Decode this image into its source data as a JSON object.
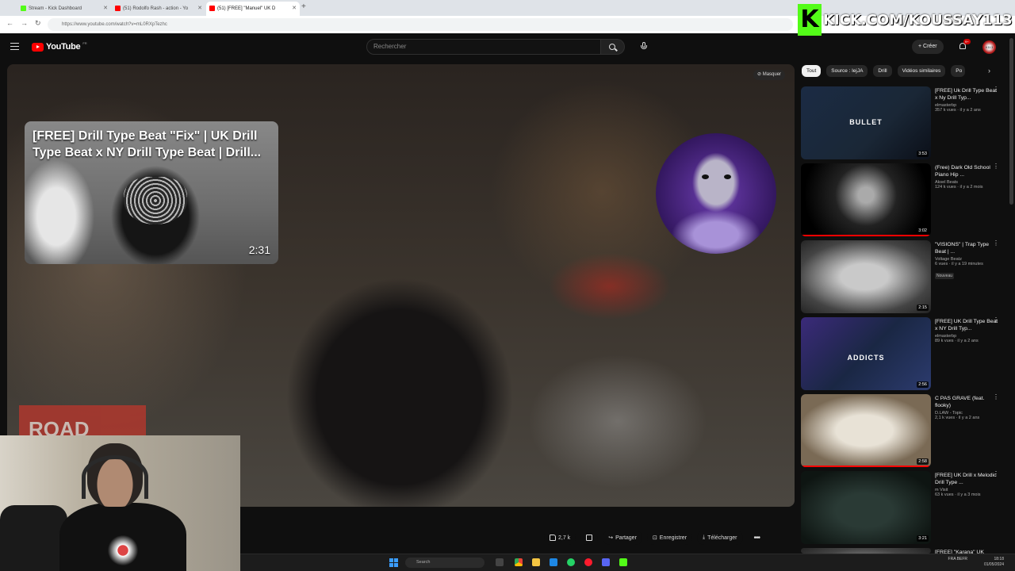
{
  "browser": {
    "tabs": [
      {
        "label": "Stream - Kick Dashboard",
        "color": "#53fc18"
      },
      {
        "label": "(51) Rodolfo Rash - action - Yo",
        "color": "#ff0000"
      },
      {
        "label": "(51) [FREE] \"Manuel\" UK D",
        "color": "#ff0000"
      }
    ],
    "url": "https://www.youtube.com/watch?v=mL0RXpTezhc"
  },
  "header": {
    "logo_text": "YouTube",
    "logo_region": "FR",
    "search_placeholder": "Rechercher",
    "create_label": "Créer",
    "notif_count": "9+",
    "avatar_text": "K113"
  },
  "overlay": {
    "kick_k": "K",
    "kick_text": "KICK.COM/KOUSSAY113"
  },
  "player": {
    "hide_label": "Masquer",
    "road_sign": "ROAD",
    "hover_card": {
      "title": "[FREE] Drill Type Beat \"Fix\" | UK Drill Type Beat x NY Drill Type Beat | Drill...",
      "duration": "2:31"
    }
  },
  "actions": {
    "likes": "2,7 k",
    "share": "Partager",
    "save": "Enregistrer",
    "download": "Télécharger"
  },
  "chips": [
    "Tout",
    "Source : lejJA",
    "Drill",
    "Vidéos similaires",
    "Po"
  ],
  "recommendations": [
    {
      "title": "[FREE] Uk Drill Type Beat x Ny Drill Typ...",
      "channel": "elmasterbp",
      "meta": "357 k vues · il y a 2 ans",
      "duration": "3:53",
      "label": "BULLET",
      "progress": 0
    },
    {
      "title": "(Free) Dark Old School Piano Hip ...",
      "channel": "Aksel Beats",
      "meta": "124 k vues · il y a 2 mois",
      "duration": "3:02",
      "label": "",
      "progress": 100
    },
    {
      "title": "\"VISIONS\" | Trap Type Beat | ...",
      "channel": "Voltage Beatz",
      "meta": "6 vues · il y a 19 minutes",
      "duration": "2:15",
      "label": "",
      "badge": "Nouveau",
      "progress": 0
    },
    {
      "title": "[FREE] UK Drill Type Beat x NY Drill Typ...",
      "channel": "elmasterbp",
      "meta": "89 k vues · il y a 2 ans",
      "duration": "2:56",
      "label": "ADDICTS",
      "progress": 0
    },
    {
      "title": "C PAS GRAVE (feat. flooky)",
      "channel": "D.LAW - Topic",
      "meta": "2,1 k vues · il y a 2 ans",
      "duration": "2:58",
      "label": "",
      "progress": 100
    },
    {
      "title": "[FREE] UK Drill x Melodic Drill Type ...",
      "channel": "m Visit",
      "meta": "63 k vues · il y a 3 mois",
      "duration": "3:21",
      "label": "",
      "progress": 0
    },
    {
      "title": "[FREE] \"Karana\" UK",
      "channel": "",
      "meta": "",
      "duration": "",
      "label": "",
      "progress": 0
    }
  ],
  "taskbar": {
    "search": "Search",
    "lang": "FRA\nBEFR",
    "time": "18:18",
    "date": "01/05/2024"
  }
}
